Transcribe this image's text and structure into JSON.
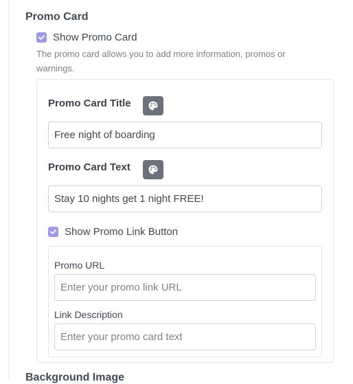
{
  "section": {
    "title": "Promo Card",
    "show_promo_card": {
      "label": "Show Promo Card",
      "checked": true
    },
    "help_text": "The promo card allows you to add more information, promos or warnings."
  },
  "promo_card": {
    "title_field": {
      "heading": "Promo Card Title",
      "value": "Free night of boarding",
      "color_button_icon": "palette-icon"
    },
    "text_field": {
      "heading": "Promo Card Text",
      "value": "Stay 10 nights get 1 night FREE!",
      "color_button_icon": "palette-icon"
    },
    "show_link_button": {
      "label": "Show Promo Link Button",
      "checked": true
    },
    "link": {
      "url_label": "Promo URL",
      "url_placeholder": "Enter your promo link URL",
      "description_label": "Link Description",
      "description_placeholder": "Enter your promo card text"
    }
  },
  "next_section": {
    "title": "Background Image"
  },
  "colors": {
    "checkbox": "#9e9ae8",
    "palette_button": "#6c727c",
    "border": "#cfd3d9"
  }
}
